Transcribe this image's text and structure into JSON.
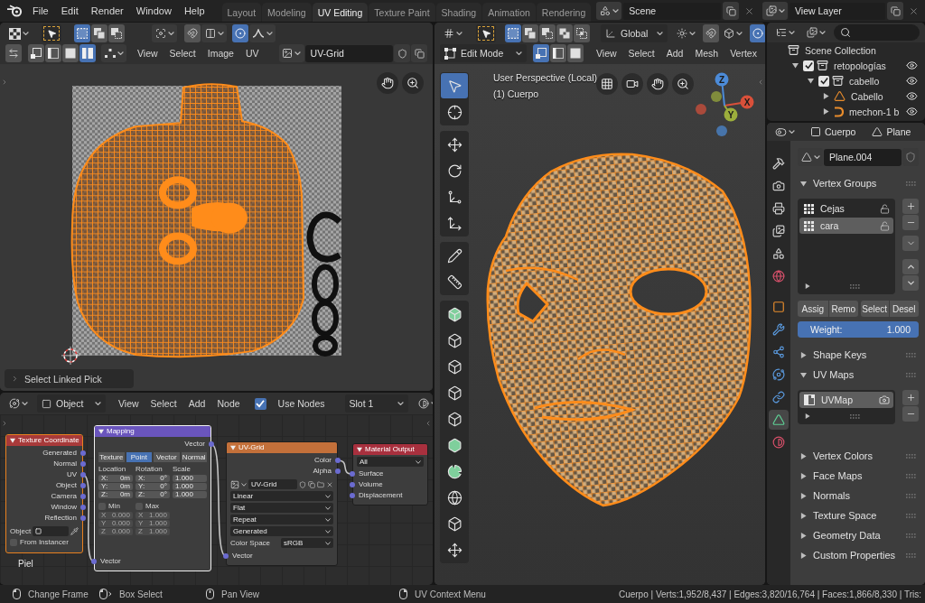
{
  "topbar": {
    "menu": [
      "File",
      "Edit",
      "Render",
      "Window",
      "Help"
    ],
    "workspaces": [
      {
        "label": "Layout",
        "selected": false
      },
      {
        "label": "Modeling",
        "selected": false
      },
      {
        "label": "UV Editing",
        "selected": true
      },
      {
        "label": "Texture Paint",
        "selected": false
      },
      {
        "label": "Shading",
        "selected": false
      },
      {
        "label": "Animation",
        "selected": false
      },
      {
        "label": "Rendering",
        "selected": false
      }
    ],
    "scene": "Scene",
    "view_layer": "View Layer"
  },
  "uv_editor": {
    "tool_modes": [
      {
        "kind": "set",
        "selected": true
      },
      {
        "kind": "extend",
        "selected": false
      },
      {
        "kind": "subtract",
        "selected": false
      }
    ],
    "snap": {
      "on": false
    },
    "proportional": {
      "on": true
    },
    "sync_selection": {
      "on": false
    },
    "select_modes": [
      {
        "kind": "vertex",
        "selected": false
      },
      {
        "kind": "edge",
        "selected": false
      },
      {
        "kind": "face",
        "selected": false
      },
      {
        "kind": "island",
        "selected": true
      }
    ],
    "menu": [
      "View",
      "Select",
      "Image",
      "UV"
    ],
    "image": "UV-Grid",
    "last_operator": "Select Linked Pick"
  },
  "node_editor": {
    "object_type": "Object",
    "menu": [
      "View",
      "Select",
      "Add",
      "Node"
    ],
    "use_nodes": {
      "label": "Use Nodes",
      "checked": true
    },
    "slot": "Slot 1",
    "note": "Piel",
    "nodes": [
      {
        "kind": "texture_coordinate",
        "title": "Texture Coordinate",
        "selected": true,
        "active": false,
        "outputs": [
          "Generated",
          "Normal",
          "UV",
          "Object",
          "Camera",
          "Window",
          "Reflection"
        ],
        "object_label": "Object",
        "from_instancer": {
          "label": "From Instancer",
          "checked": false
        }
      },
      {
        "kind": "mapping",
        "title": "Mapping",
        "selected": true,
        "active": true,
        "outputs": [
          "Vector"
        ],
        "vector_types": [
          {
            "label": "Texture",
            "selected": false
          },
          {
            "label": "Point",
            "selected": true
          },
          {
            "label": "Vector",
            "selected": false
          },
          {
            "label": "Normal",
            "selected": false
          }
        ],
        "columns": [
          {
            "label": "Location",
            "fields": [
              {
                "axis": "X:",
                "value": "0m"
              },
              {
                "axis": "Y:",
                "value": "0m"
              },
              {
                "axis": "Z:",
                "value": "0m"
              }
            ]
          },
          {
            "label": "Rotation",
            "fields": [
              {
                "axis": "X:",
                "value": "0°"
              },
              {
                "axis": "Y:",
                "value": "0°"
              },
              {
                "axis": "Z:",
                "value": "0°"
              }
            ]
          },
          {
            "label": "Scale",
            "fields": [
              {
                "value": "1.000"
              },
              {
                "value": "1.000"
              },
              {
                "value": "1.000"
              }
            ]
          }
        ],
        "limits": [
          {
            "label": "Min",
            "checked": false,
            "fields": [
              {
                "axis": "X",
                "value": "0.000"
              },
              {
                "axis": "Y",
                "value": "0.000"
              },
              {
                "axis": "Z",
                "value": "0.000"
              }
            ]
          },
          {
            "label": "Max",
            "checked": false,
            "fields": [
              {
                "axis": "X",
                "value": "1.000"
              },
              {
                "axis": "Y",
                "value": "1.000"
              },
              {
                "axis": "Z",
                "value": "1.000"
              }
            ]
          }
        ],
        "inputs": [
          "Vector"
        ]
      },
      {
        "kind": "image_texture",
        "title": "UV-Grid",
        "selected": false,
        "active": false,
        "outputs": [
          "Color",
          "Alpha"
        ],
        "image": "UV-Grid",
        "options": [
          "Linear",
          "Flat",
          "Repeat",
          "Generated"
        ],
        "color_space": {
          "label": "Color Space",
          "value": "sRGB"
        },
        "inputs": [
          "Vector"
        ]
      },
      {
        "kind": "material_output",
        "title": "Material Output",
        "selected": false,
        "active": false,
        "target": "All",
        "inputs": [
          "Surface",
          "Volume",
          "Displacement"
        ]
      }
    ]
  },
  "viewport": {
    "tool_modes": [
      {
        "kind": "set",
        "selected": true
      },
      {
        "kind": "extend",
        "selected": false
      },
      {
        "kind": "subtract",
        "selected": false
      },
      {
        "kind": "difference",
        "selected": false
      },
      {
        "kind": "intersect",
        "selected": false
      }
    ],
    "orientation": "Global",
    "snap": {
      "on": false
    },
    "proportional": {
      "on": true
    },
    "mode": "Edit Mode",
    "select_modes": [
      {
        "kind": "vertex",
        "selected": true
      },
      {
        "kind": "edge",
        "selected": false
      },
      {
        "kind": "face",
        "selected": false
      }
    ],
    "menu": [
      "View",
      "Select",
      "Add",
      "Mesh",
      "Vertex"
    ],
    "overlay": [
      "User Perspective (Local)",
      "(1) Cuerpo"
    ],
    "gizmo": [
      {
        "label": "X",
        "color": "#d9503a"
      },
      {
        "label": "Y",
        "color": "#9cae3c"
      },
      {
        "label": "Z",
        "color": "#4c8bd8"
      }
    ],
    "toolbar": [
      {
        "tools": [
          {
            "kind": "select_box",
            "selected": true
          },
          {
            "kind": "cursor",
            "selected": false
          }
        ]
      },
      {
        "tools": [
          {
            "kind": "move",
            "selected": false
          },
          {
            "kind": "rotate",
            "selected": false
          },
          {
            "kind": "scale",
            "selected": false
          },
          {
            "kind": "transform",
            "selected": false
          }
        ]
      },
      {
        "tools": [
          {
            "kind": "annotate",
            "selected": false
          },
          {
            "kind": "measure",
            "selected": false
          }
        ]
      },
      {
        "tools": [
          {
            "kind": "extrude",
            "selected": false
          },
          {
            "kind": "inset",
            "selected": false
          },
          {
            "kind": "bevel",
            "selected": false
          },
          {
            "kind": "loop_cut",
            "selected": false
          },
          {
            "kind": "knife",
            "selected": false
          },
          {
            "kind": "poly_build",
            "selected": false
          },
          {
            "kind": "spin",
            "selected": false
          },
          {
            "kind": "smooth",
            "selected": false
          },
          {
            "kind": "shear",
            "selected": false
          },
          {
            "kind": "shrink",
            "selected": false
          }
        ]
      }
    ]
  },
  "outliner": {
    "tree": [
      {
        "kind": "scene_collection",
        "label": "Scene Collection",
        "children": [
          {
            "kind": "collection",
            "label": "retopologías",
            "expanded": true,
            "checked": true,
            "visible": true,
            "children": [
              {
                "kind": "collection",
                "label": "cabello",
                "expanded": true,
                "checked": true,
                "visible": true,
                "children": [
                  {
                    "kind": "mesh",
                    "label": "Cabello",
                    "expanded": false,
                    "visible": true
                  },
                  {
                    "kind": "curve",
                    "label": "mechon-1 b",
                    "expanded": false,
                    "visible": true
                  }
                ]
              }
            ]
          }
        ]
      }
    ]
  },
  "properties": {
    "object": "Cuerpo",
    "data": "Plane",
    "tabs": [
      {
        "kind": "tool",
        "selected": false
      },
      {
        "kind": "render",
        "selected": false
      },
      {
        "kind": "output",
        "selected": false
      },
      {
        "kind": "view_layer",
        "selected": false
      },
      {
        "kind": "scene",
        "selected": false
      },
      {
        "kind": "world",
        "selected": false
      },
      {
        "kind": "object",
        "selected": false
      },
      {
        "kind": "modifiers",
        "selected": false
      },
      {
        "kind": "particles",
        "selected": false
      },
      {
        "kind": "physics",
        "selected": false
      },
      {
        "kind": "constraints",
        "selected": false
      },
      {
        "kind": "data",
        "selected": true
      },
      {
        "kind": "material",
        "selected": false
      }
    ],
    "mesh": "Plane.004",
    "panels": [
      {
        "kind": "vertex_groups",
        "title": "Vertex Groups",
        "expanded": true,
        "items": [
          {
            "label": "Cejas",
            "selected": false
          },
          {
            "label": "cara",
            "selected": true
          }
        ],
        "buttons": [
          "Assig",
          "Remo",
          "Select",
          "Desel"
        ],
        "weight": {
          "label": "Weight:",
          "value": "1.000",
          "level": 1
        }
      },
      {
        "kind": "plain",
        "title": "Shape Keys",
        "expanded": false
      },
      {
        "kind": "uv_maps",
        "title": "UV Maps",
        "expanded": true,
        "items": [
          {
            "label": "UVMap",
            "selected": true
          }
        ]
      },
      {
        "kind": "plain",
        "title": "Vertex Colors",
        "expanded": false
      },
      {
        "kind": "plain",
        "title": "Face Maps",
        "expanded": false
      },
      {
        "kind": "plain",
        "title": "Normals",
        "expanded": false
      },
      {
        "kind": "plain",
        "title": "Texture Space",
        "expanded": false
      },
      {
        "kind": "plain",
        "title": "Geometry Data",
        "expanded": false
      },
      {
        "kind": "plain",
        "title": "Custom Properties",
        "expanded": false
      }
    ]
  },
  "status_bar": {
    "hints": [
      {
        "kind": "left_click",
        "label": "Change Frame"
      },
      {
        "kind": "left_drag",
        "label": "Box Select"
      },
      {
        "kind": "middle_click",
        "label": "Pan View"
      },
      {
        "kind": "right_click",
        "label": "UV Context Menu"
      }
    ],
    "stats": "Cuerpo | Verts:1,952/8,437 | Edges:3,820/16,764 | Faces:1,866/8,330 | Tris:"
  }
}
